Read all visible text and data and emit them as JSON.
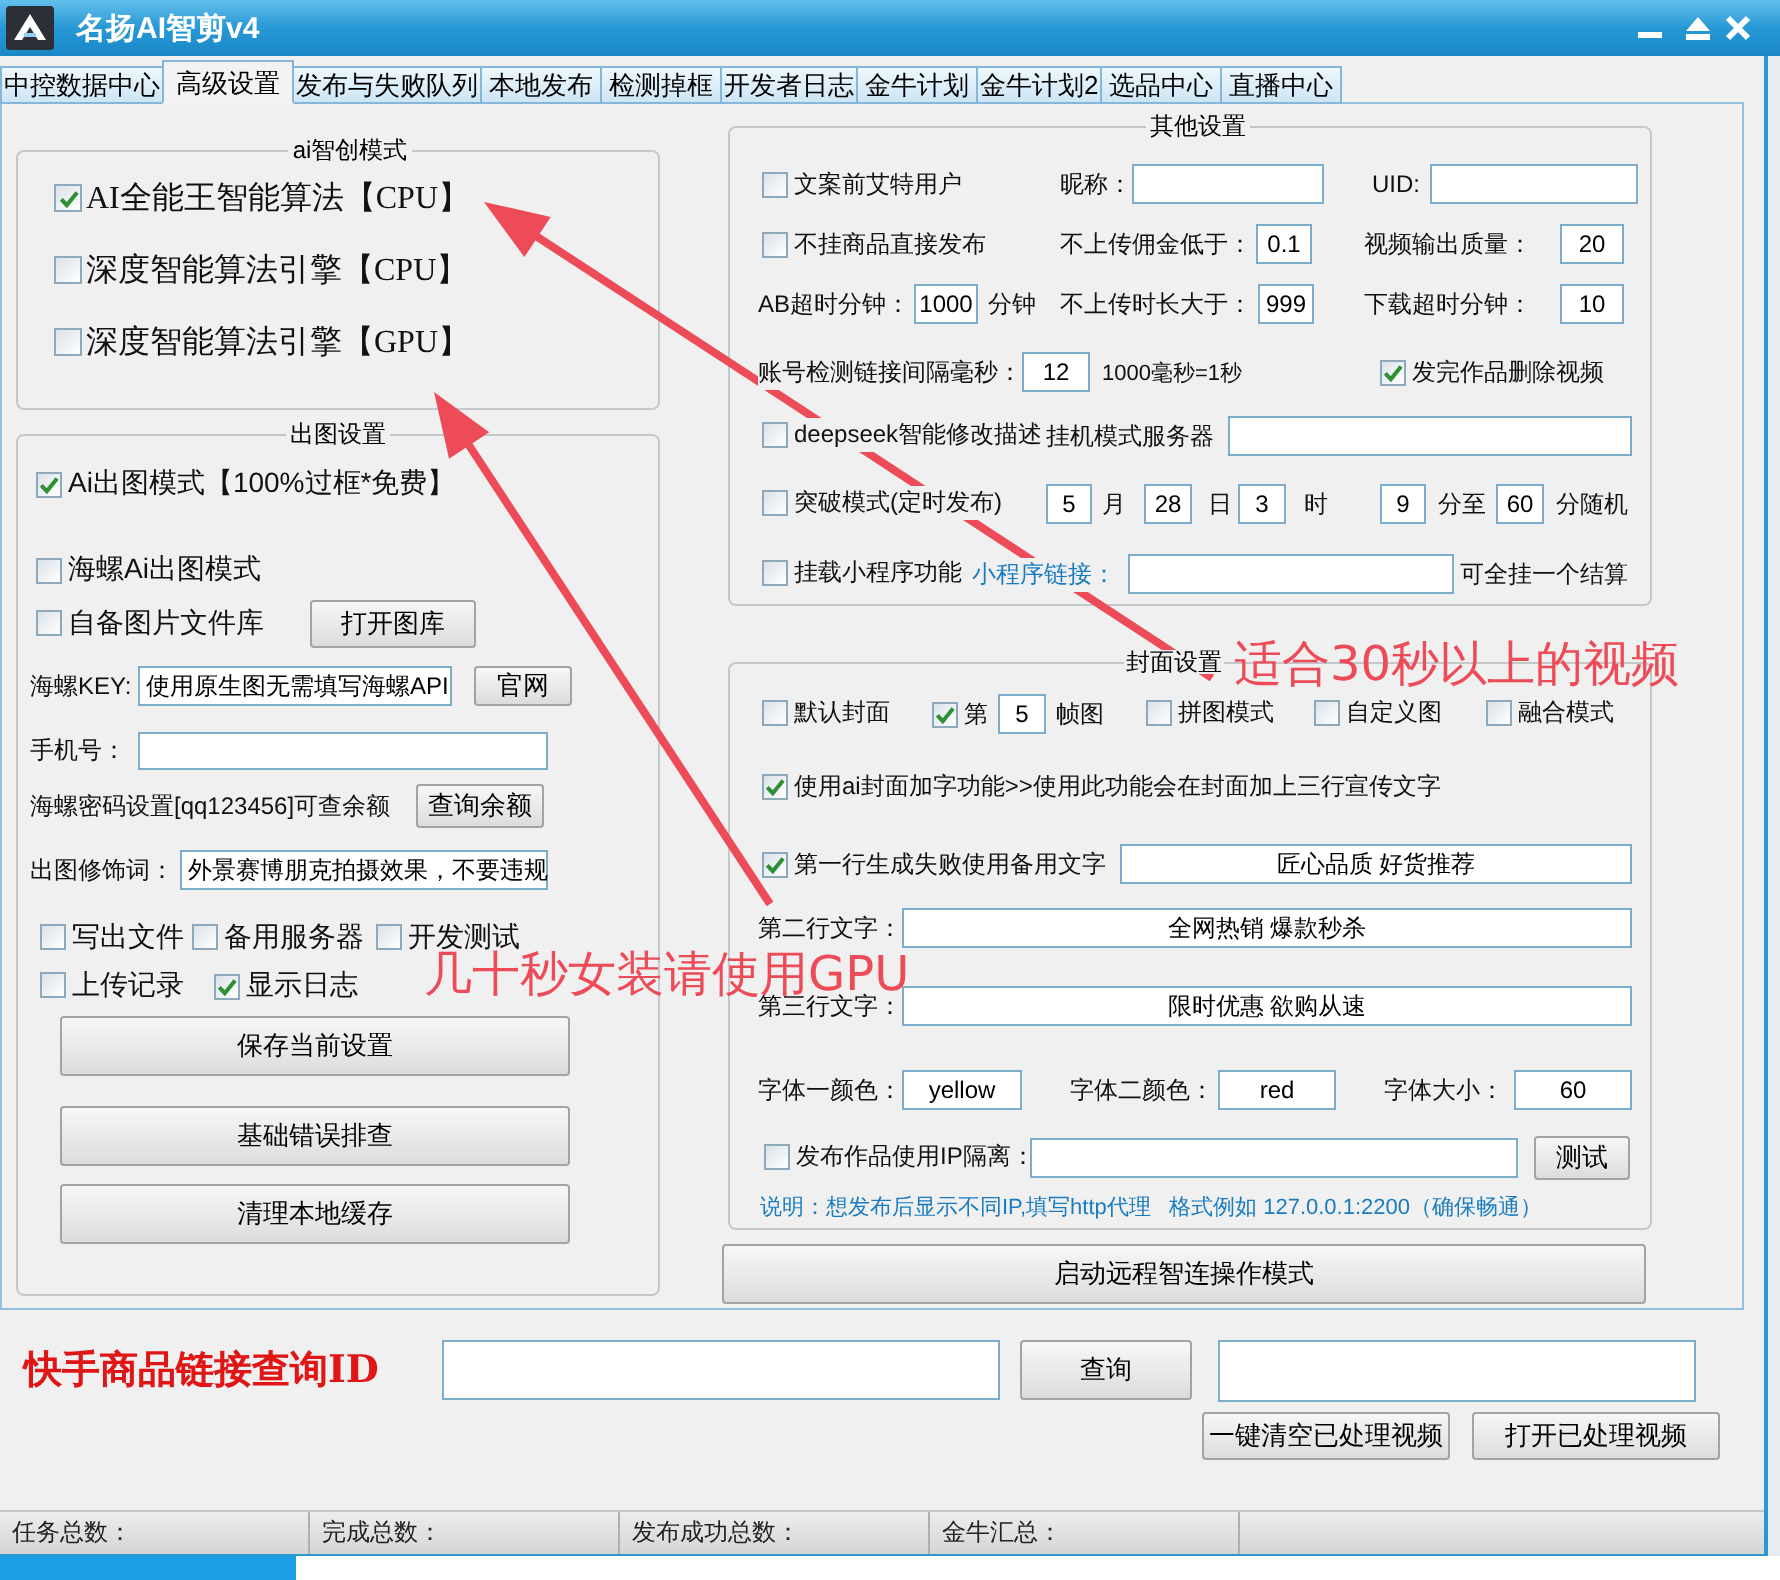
{
  "window": {
    "title": "名扬AI智剪v4"
  },
  "tabs": [
    {
      "label": "中控数据中心",
      "selected": false
    },
    {
      "label": "高级设置",
      "selected": true
    },
    {
      "label": "发布与失败队列",
      "selected": false
    },
    {
      "label": "本地发布",
      "selected": false
    },
    {
      "label": "检测掉框",
      "selected": false
    },
    {
      "label": "开发者日志",
      "selected": false
    },
    {
      "label": "金牛计划",
      "selected": false
    },
    {
      "label": "金牛计划2",
      "selected": false
    },
    {
      "label": "选品中心",
      "selected": false
    },
    {
      "label": "直播中心",
      "selected": false
    }
  ],
  "ai_mode": {
    "title": "ai智创模式",
    "options": [
      {
        "label": "AI全能王智能算法【CPU】",
        "checked": true
      },
      {
        "label": "深度智能算法引擎【CPU】",
        "checked": false
      },
      {
        "label": "深度智能算法引擎【GPU】",
        "checked": false
      }
    ]
  },
  "image_settings": {
    "title": "出图设置",
    "ai_image": {
      "label": "Ai出图模式【100%过框*免费】",
      "checked": true
    },
    "hailuo_image": {
      "label": "海螺Ai出图模式",
      "checked": false
    },
    "own_library": {
      "label": "自备图片文件库",
      "checked": false
    },
    "open_library_button": "打开图库",
    "key": {
      "label": "海螺KEY:",
      "value": "使用原生图无需填写海螺API"
    },
    "website_button": "官网",
    "phone": {
      "label": "手机号："
    },
    "password_hint": "海螺密码设置[qq123456]可查余额",
    "balance_button": "查询余额",
    "prompt": {
      "label": "出图修饰词：",
      "value": "外景赛博朋克拍摄效果，不要违规"
    },
    "option_rows": [
      [
        {
          "label": "写出文件",
          "checked": false
        },
        {
          "label": "备用服务器",
          "checked": false
        },
        {
          "label": "开发测试",
          "checked": false
        }
      ],
      [
        {
          "label": "上传记录",
          "checked": false
        },
        {
          "label": "显示日志",
          "checked": true
        }
      ]
    ],
    "buttons": [
      "保存当前设置",
      "基础错误排查",
      "清理本地缓存"
    ]
  },
  "other_settings": {
    "title": "其他设置",
    "mention_users": {
      "label": "文案前艾特用户",
      "checked": false
    },
    "nickname": {
      "label": "昵称："
    },
    "uid": {
      "label": "UID:"
    },
    "no_product_publish": {
      "label": "不挂商品直接发布",
      "checked": false
    },
    "min_commission": {
      "label": "不上传佣金低于：",
      "value": "0.1"
    },
    "output_quality": {
      "label": "视频输出质量：",
      "value": "20"
    },
    "ab_timeout": {
      "label": "AB超时分钟：",
      "value": "1000",
      "unit": "分钟"
    },
    "max_duration": {
      "label": "不上传时长大于：",
      "value": "999"
    },
    "download_timeout": {
      "label": "下载超时分钟：",
      "value": "10"
    },
    "check_interval": {
      "label": "账号检测链接间隔毫秒：",
      "value": "12",
      "note": "1000毫秒=1秒"
    },
    "delete_after_publish": {
      "label": "发完作品删除视频",
      "checked": true
    },
    "deepseek": {
      "label": "deepseek智能修改描述",
      "checked": false
    },
    "server": {
      "label": "挂机模式服务器"
    },
    "breakthrough": {
      "label": "突破模式(定时发布)",
      "checked": false,
      "month": "5",
      "month_unit": "月",
      "day": "28",
      "day_unit": "日",
      "hour": "3",
      "hour_unit": "时",
      "minute_from": "9",
      "from_unit": "分至",
      "minute_to": "60",
      "to_unit": "分随机"
    },
    "mini_program": {
      "label": "挂载小程序功能",
      "checked": false,
      "link_label": "小程序链接：",
      "note": "可全挂一个结算"
    }
  },
  "cover_settings": {
    "title": "封面设置",
    "default_cover": {
      "label": "默认封面",
      "checked": false
    },
    "frame": {
      "label": "第",
      "checked": true,
      "value": "5",
      "unit": "帧图"
    },
    "collage": {
      "label": "拼图模式",
      "checked": false
    },
    "custom_image": {
      "label": "自定义图",
      "checked": false
    },
    "blend": {
      "label": "融合模式",
      "checked": false
    },
    "ai_text": {
      "label": "使用ai封面加字功能>>使用此功能会在封面加上三行宣传文字",
      "checked": true
    },
    "line1": {
      "label": "第一行生成失败使用备用文字",
      "checked": true,
      "value": "匠心品质 好货推荐"
    },
    "line2": {
      "label": "第二行文字：",
      "value": "全网热销 爆款秒杀"
    },
    "line3": {
      "label": "第三行文字：",
      "value": "限时优惠 欲购从速"
    },
    "font1_color": {
      "label": "字体一颜色：",
      "value": "yellow"
    },
    "font2_color": {
      "label": "字体二颜色：",
      "value": "red"
    },
    "font_size": {
      "label": "字体大小：",
      "value": "60"
    },
    "ip_isolation": {
      "label": "发布作品使用IP隔离：",
      "checked": false
    },
    "test_button": "测试",
    "note": "说明：想发布后显示不同IP,填写http代理   格式例如 127.0.0.1:2200（确保畅通）"
  },
  "remote_button": "启动远程智连操作模式",
  "lookup": {
    "label": "快手商品链接查询ID",
    "query_button": "查询",
    "clear_button": "一键清空已处理视频",
    "open_button": "打开已处理视频"
  },
  "status_bar": [
    "任务总数：",
    "完成总数：",
    "发布成功总数：",
    "金牛汇总："
  ],
  "annotations": [
    "适合30秒以上的视频",
    "几十秒女装请使用GPU"
  ]
}
